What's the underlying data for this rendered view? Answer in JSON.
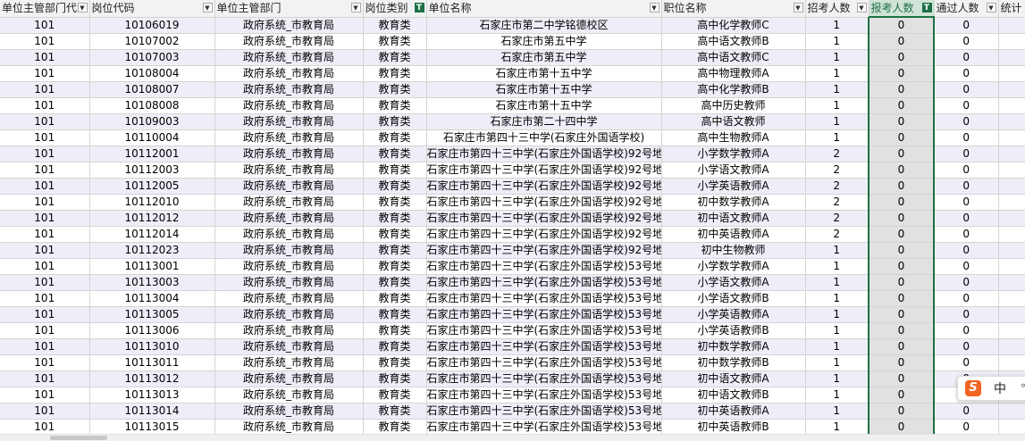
{
  "headers": [
    {
      "label": "单位主管部门代",
      "filter": "normal"
    },
    {
      "label": "岗位代码",
      "filter": "normal"
    },
    {
      "label": "单位主管部门",
      "filter": "normal"
    },
    {
      "label": "岗位类别",
      "filter": "active"
    },
    {
      "label": "单位名称",
      "filter": "normal"
    },
    {
      "label": "职位名称",
      "filter": "normal"
    },
    {
      "label": "招考人数",
      "filter": "normal"
    },
    {
      "label": "报考人数",
      "filter": "active"
    },
    {
      "label": "通过人数",
      "filter": "normal"
    },
    {
      "label": "统计",
      "filter": "none"
    }
  ],
  "rows": [
    [
      "101",
      "10106019",
      "政府系统_市教育局",
      "教育类",
      "石家庄市第二中学铭德校区",
      "高中化学教师C",
      "1",
      "0",
      "0"
    ],
    [
      "101",
      "10107002",
      "政府系统_市教育局",
      "教育类",
      "石家庄市第五中学",
      "高中语文教师B",
      "1",
      "0",
      "0"
    ],
    [
      "101",
      "10107003",
      "政府系统_市教育局",
      "教育类",
      "石家庄市第五中学",
      "高中语文教师C",
      "1",
      "0",
      "0"
    ],
    [
      "101",
      "10108004",
      "政府系统_市教育局",
      "教育类",
      "石家庄市第十五中学",
      "高中物理教师A",
      "1",
      "0",
      "0"
    ],
    [
      "101",
      "10108007",
      "政府系统_市教育局",
      "教育类",
      "石家庄市第十五中学",
      "高中化学教师B",
      "1",
      "0",
      "0"
    ],
    [
      "101",
      "10108008",
      "政府系统_市教育局",
      "教育类",
      "石家庄市第十五中学",
      "高中历史教师",
      "1",
      "0",
      "0"
    ],
    [
      "101",
      "10109003",
      "政府系统_市教育局",
      "教育类",
      "石家庄市第二十四中学",
      "高中语文教师",
      "1",
      "0",
      "0"
    ],
    [
      "101",
      "10110004",
      "政府系统_市教育局",
      "教育类",
      "石家庄市第四十三中学(石家庄外国语学校)",
      "高中生物教师A",
      "1",
      "0",
      "0"
    ],
    [
      "101",
      "10112001",
      "政府系统_市教育局",
      "教育类",
      "石家庄市第四十三中学(石家庄外国语学校)92号地",
      "小学数学教师A",
      "2",
      "0",
      "0"
    ],
    [
      "101",
      "10112003",
      "政府系统_市教育局",
      "教育类",
      "石家庄市第四十三中学(石家庄外国语学校)92号地",
      "小学语文教师A",
      "2",
      "0",
      "0"
    ],
    [
      "101",
      "10112005",
      "政府系统_市教育局",
      "教育类",
      "石家庄市第四十三中学(石家庄外国语学校)92号地",
      "小学英语教师A",
      "2",
      "0",
      "0"
    ],
    [
      "101",
      "10112010",
      "政府系统_市教育局",
      "教育类",
      "石家庄市第四十三中学(石家庄外国语学校)92号地",
      "初中数学教师A",
      "2",
      "0",
      "0"
    ],
    [
      "101",
      "10112012",
      "政府系统_市教育局",
      "教育类",
      "石家庄市第四十三中学(石家庄外国语学校)92号地",
      "初中语文教师A",
      "2",
      "0",
      "0"
    ],
    [
      "101",
      "10112014",
      "政府系统_市教育局",
      "教育类",
      "石家庄市第四十三中学(石家庄外国语学校)92号地",
      "初中英语教师A",
      "2",
      "0",
      "0"
    ],
    [
      "101",
      "10112023",
      "政府系统_市教育局",
      "教育类",
      "石家庄市第四十三中学(石家庄外国语学校)92号地",
      "初中生物教师",
      "1",
      "0",
      "0"
    ],
    [
      "101",
      "10113001",
      "政府系统_市教育局",
      "教育类",
      "石家庄市第四十三中学(石家庄外国语学校)53号地",
      "小学数学教师A",
      "1",
      "0",
      "0"
    ],
    [
      "101",
      "10113003",
      "政府系统_市教育局",
      "教育类",
      "石家庄市第四十三中学(石家庄外国语学校)53号地",
      "小学语文教师A",
      "1",
      "0",
      "0"
    ],
    [
      "101",
      "10113004",
      "政府系统_市教育局",
      "教育类",
      "石家庄市第四十三中学(石家庄外国语学校)53号地",
      "小学语文教师B",
      "1",
      "0",
      "0"
    ],
    [
      "101",
      "10113005",
      "政府系统_市教育局",
      "教育类",
      "石家庄市第四十三中学(石家庄外国语学校)53号地",
      "小学英语教师A",
      "1",
      "0",
      "0"
    ],
    [
      "101",
      "10113006",
      "政府系统_市教育局",
      "教育类",
      "石家庄市第四十三中学(石家庄外国语学校)53号地",
      "小学英语教师B",
      "1",
      "0",
      "0"
    ],
    [
      "101",
      "10113010",
      "政府系统_市教育局",
      "教育类",
      "石家庄市第四十三中学(石家庄外国语学校)53号地",
      "初中数学教师A",
      "1",
      "0",
      "0"
    ],
    [
      "101",
      "10113011",
      "政府系统_市教育局",
      "教育类",
      "石家庄市第四十三中学(石家庄外国语学校)53号地",
      "初中数学教师B",
      "1",
      "0",
      "0"
    ],
    [
      "101",
      "10113012",
      "政府系统_市教育局",
      "教育类",
      "石家庄市第四十三中学(石家庄外国语学校)53号地",
      "初中语文教师A",
      "1",
      "0",
      "0"
    ],
    [
      "101",
      "10113013",
      "政府系统_市教育局",
      "教育类",
      "石家庄市第四十三中学(石家庄外国语学校)53号地",
      "初中语文教师B",
      "1",
      "0",
      "0"
    ],
    [
      "101",
      "10113014",
      "政府系统_市教育局",
      "教育类",
      "石家庄市第四十三中学(石家庄外国语学校)53号地",
      "初中英语教师A",
      "1",
      "0",
      "0"
    ],
    [
      "101",
      "10113015",
      "政府系统_市教育局",
      "教育类",
      "石家庄市第四十三中学(石家庄外国语学校)53号地",
      "初中英语教师B",
      "1",
      "0",
      "0"
    ]
  ],
  "ime": {
    "logo": "S",
    "lang": "中",
    "extra": "°,"
  },
  "colors": {
    "accent": "#1e7145",
    "row_alt": "#eeeef8",
    "selected_col": "#e1e1e1",
    "ime_logo": "#f26522"
  },
  "icons": {
    "filter": "filter-dropdown-icon",
    "filter_active": "filter-active-icon"
  }
}
